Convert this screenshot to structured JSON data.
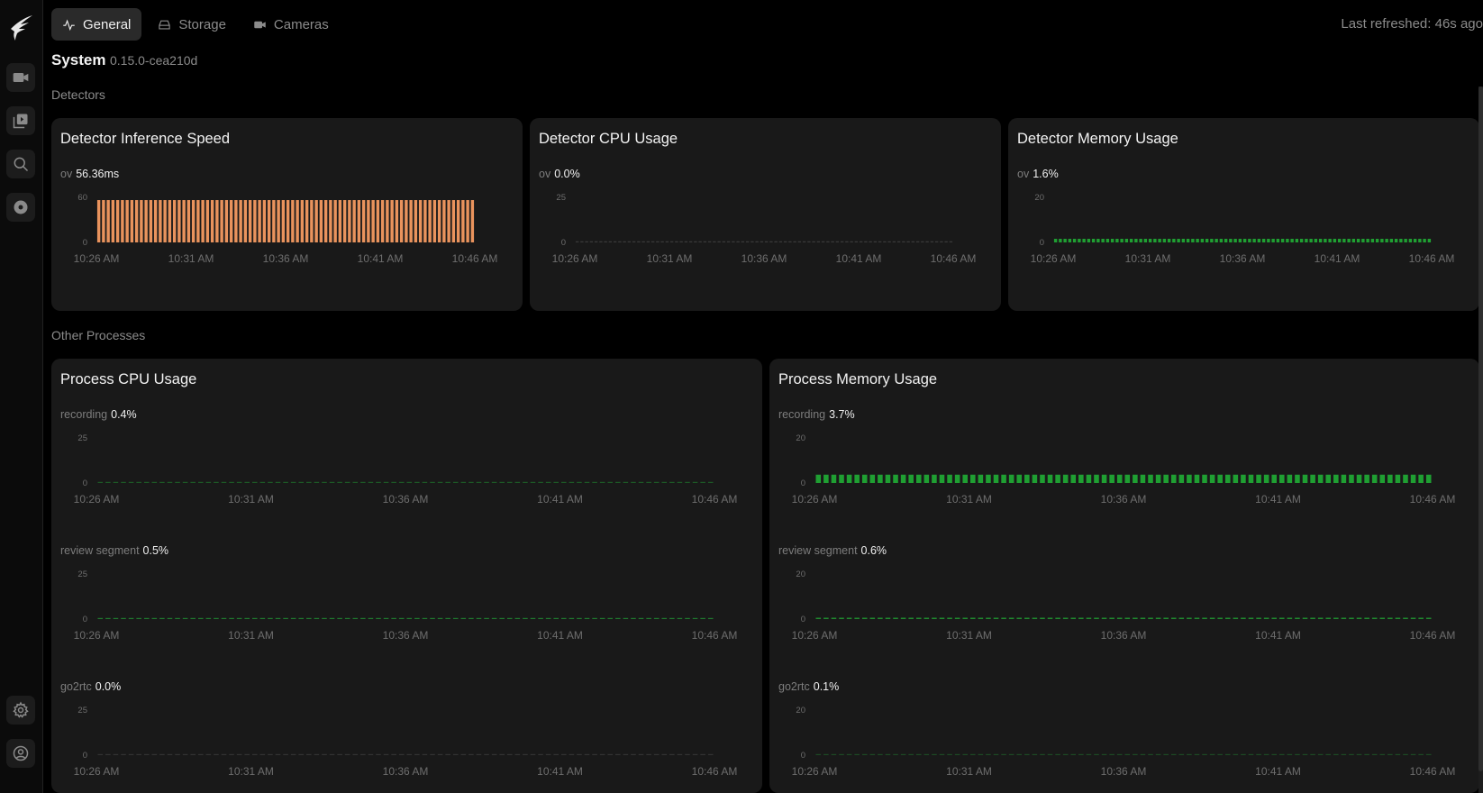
{
  "sidebar": {
    "logo": "frigate-logo",
    "items": [
      {
        "name": "live",
        "icon": "video-camera-icon"
      },
      {
        "name": "review",
        "icon": "media-library-icon"
      },
      {
        "name": "explore",
        "icon": "search-icon"
      },
      {
        "name": "export",
        "icon": "disc-icon"
      }
    ],
    "bottom": [
      {
        "name": "settings",
        "icon": "gear-icon"
      },
      {
        "name": "account",
        "icon": "user-circle-icon"
      }
    ]
  },
  "tabs": [
    {
      "label": "General",
      "icon": "activity-icon",
      "active": true
    },
    {
      "label": "Storage",
      "icon": "hard-drive-icon",
      "active": false
    },
    {
      "label": "Cameras",
      "icon": "video-camera-icon",
      "active": false
    }
  ],
  "last_refreshed": "Last refreshed: 46s ago",
  "system": {
    "title": "System",
    "version": "0.15.0-cea210d"
  },
  "sections": {
    "detectors": "Detectors",
    "other": "Other Processes"
  },
  "colors": {
    "orange": "#e9935d",
    "green": "#1f9f32",
    "muted_green": "#1c5a26",
    "dash_gray": "#3a3a3a"
  },
  "x_ticks": [
    "10:26 AM",
    "10:31 AM",
    "10:36 AM",
    "10:41 AM",
    "10:46 AM"
  ],
  "cards": {
    "inference": {
      "title": "Detector Inference Speed",
      "label": "ov",
      "value": "56.36ms"
    },
    "det_cpu": {
      "title": "Detector CPU Usage",
      "label": "ov",
      "value": "0.0%"
    },
    "det_mem": {
      "title": "Detector Memory Usage",
      "label": "ov",
      "value": "1.6%"
    },
    "proc_cpu": {
      "title": "Process CPU Usage",
      "rows": [
        {
          "label": "recording",
          "value": "0.4%"
        },
        {
          "label": "review segment",
          "value": "0.5%"
        },
        {
          "label": "go2rtc",
          "value": "0.0%"
        }
      ]
    },
    "proc_mem": {
      "title": "Process Memory Usage",
      "rows": [
        {
          "label": "recording",
          "value": "3.7%"
        },
        {
          "label": "review segment",
          "value": "0.6%"
        },
        {
          "label": "go2rtc",
          "value": "0.1%"
        }
      ]
    }
  },
  "chart_data": [
    {
      "id": "inference",
      "type": "bar",
      "y_ticks": [
        "0",
        "60"
      ],
      "ylim": [
        0,
        60
      ],
      "n": 80,
      "value": 56.36,
      "color": "#e9935d"
    },
    {
      "id": "det_cpu",
      "type": "bar",
      "y_ticks": [
        "0",
        "25"
      ],
      "ylim": [
        0,
        25
      ],
      "n": 80,
      "value": 0.0,
      "color": "#3a3a3a"
    },
    {
      "id": "det_mem",
      "type": "bar",
      "y_ticks": [
        "0",
        "20"
      ],
      "ylim": [
        0,
        20
      ],
      "n": 80,
      "value": 1.6,
      "color": "#1f9f32"
    },
    {
      "id": "pc_recording",
      "type": "bar",
      "y_ticks": [
        "0",
        "25"
      ],
      "ylim": [
        0,
        25
      ],
      "n": 80,
      "value": 0.4,
      "color": "#1c5a26"
    },
    {
      "id": "pc_review",
      "type": "bar",
      "y_ticks": [
        "0",
        "25"
      ],
      "ylim": [
        0,
        25
      ],
      "n": 80,
      "value": 0.5,
      "color": "#1f7a2e"
    },
    {
      "id": "pc_go2rtc",
      "type": "bar",
      "y_ticks": [
        "0",
        "25"
      ],
      "ylim": [
        0,
        25
      ],
      "n": 80,
      "value": 0.0,
      "color": "#333333"
    },
    {
      "id": "pm_recording",
      "type": "bar",
      "y_ticks": [
        "0",
        "20"
      ],
      "ylim": [
        0,
        20
      ],
      "n": 80,
      "value": 3.7,
      "color": "#1f9f32"
    },
    {
      "id": "pm_review",
      "type": "bar",
      "y_ticks": [
        "0",
        "20"
      ],
      "ylim": [
        0,
        20
      ],
      "n": 80,
      "value": 0.6,
      "color": "#1f8a2e"
    },
    {
      "id": "pm_go2rtc",
      "type": "bar",
      "y_ticks": [
        "0",
        "20"
      ],
      "ylim": [
        0,
        20
      ],
      "n": 80,
      "value": 0.1,
      "color": "#1c4a24"
    }
  ]
}
